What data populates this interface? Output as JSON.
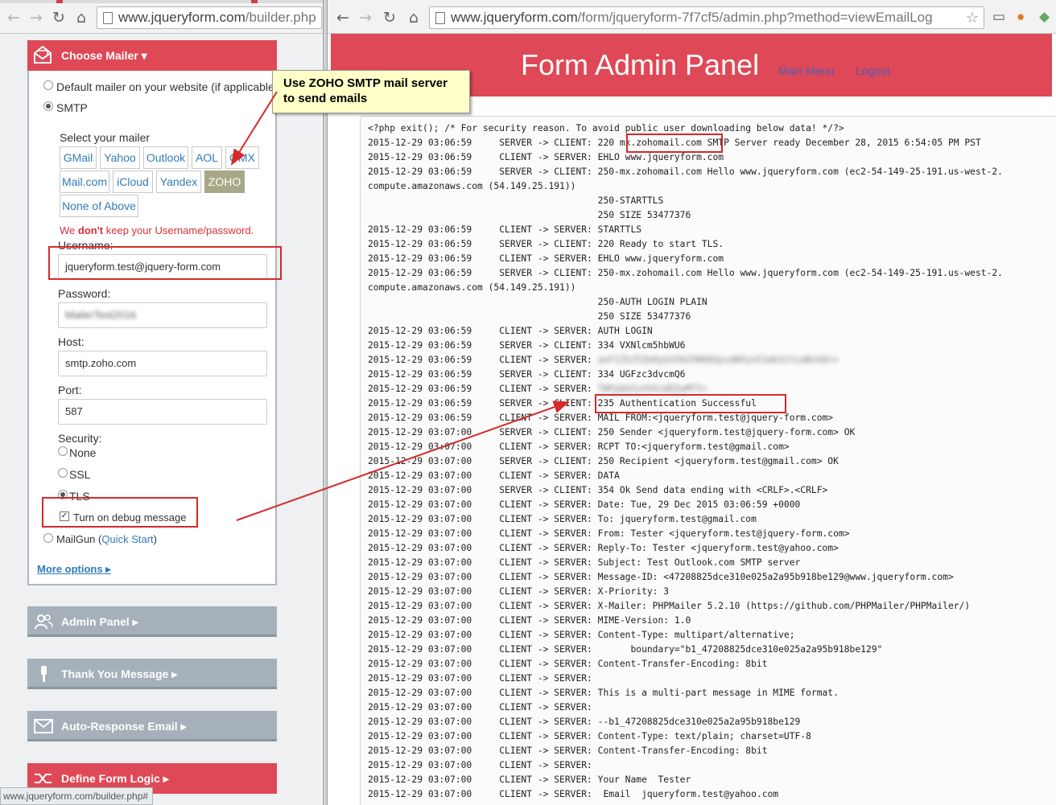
{
  "left_browser": {
    "url_host": "www.jqueryform.com",
    "url_rest": "/builder.php"
  },
  "right_browser": {
    "url_host": "www.jqueryform.com",
    "url_rest": "/form/jqueryform-7f7cf5/admin.php?method=viewEmailLog"
  },
  "mailer": {
    "title": "Choose Mailer ▾",
    "default_option": "Default mailer on your website (if applicable)",
    "smtp_option": "SMTP",
    "select_label": "Select your mailer",
    "buttons_row1": [
      "GMail",
      "Yahoo",
      "Outlook",
      "AOL",
      "GMX"
    ],
    "buttons_row2": [
      "Mail.com",
      "iCloud",
      "Yandex",
      "ZOHO"
    ],
    "buttons_row3": [
      "None of Above"
    ],
    "warning_pre": "We ",
    "warning_bold": "don't",
    "warning_post": " keep your Username/password.",
    "username_label": "Username:",
    "username_value": "jqueryform.test@jquery-form.com",
    "password_label": "Password:",
    "password_value": "MailerTest2016",
    "host_label": "Host:",
    "host_value": "smtp.zoho.com",
    "port_label": "Port:",
    "port_value": "587",
    "security_label": "Security:",
    "security_none": "None",
    "security_ssl": "SSL",
    "security_tls": "TLS",
    "debug_label": "Turn on debug message",
    "mailgun_label": "MailGun (",
    "mailgun_link": "Quick Start",
    "mailgun_close": ")",
    "more_options": "More options ▸"
  },
  "sections": {
    "admin_panel": "Admin Panel ▸",
    "thank_you": "Thank You Message ▸",
    "auto_response": "Auto-Response Email ▸",
    "form_logic": "Define Form Logic ▸"
  },
  "status_bar": "www.jqueryform.com/builder.php#",
  "callout": {
    "line1": "Use ZOHO SMTP mail server",
    "line2": "to send emails"
  },
  "admin": {
    "title": "Form Admin Panel",
    "main_menu": "Main Menu",
    "logout": "Logout"
  },
  "log_lines": [
    "<?php exit(); /* For security reason. To avoid public user downloading below data! */?>",
    "2015-12-29 03:06:59     SERVER -> CLIENT: 220 mx.zohomail.com SMTP Server ready December 28, 2015 6:54:05 PM PST",
    "2015-12-29 03:06:59     CLIENT -> SERVER: EHLO www.jqueryform.com",
    "2015-12-29 03:06:59     SERVER -> CLIENT: 250-mx.zohomail.com Hello www.jqueryform.com (ec2-54-149-25-191.us-west-2.",
    "compute.amazonaws.com (54.149.25.191))",
    "                                          250-STARTTLS",
    "                                          250 SIZE 53477376",
    "2015-12-29 03:06:59     CLIENT -> SERVER: STARTTLS",
    "2015-12-29 03:06:59     SERVER -> CLIENT: 220 Ready to start TLS.",
    "2015-12-29 03:06:59     CLIENT -> SERVER: EHLO www.jqueryform.com",
    "2015-12-29 03:06:59     SERVER -> CLIENT: 250-mx.zohomail.com Hello www.jqueryform.com (ec2-54-149-25-191.us-west-2.",
    "compute.amazonaws.com (54.149.25.191))",
    "                                          250-AUTH LOGIN PLAIN",
    "                                          250 SIZE 53477376",
    "2015-12-29 03:06:59     CLIENT -> SERVER: AUTH LOGIN",
    "2015-12-29 03:06:59     SERVER -> CLIENT: 334 VXNlcm5hbWU6",
    "2015-12-29 03:06:59     CLIENT -> SERVER: ",
    "2015-12-29 03:06:59     SERVER -> CLIENT: 334 UGFzc3dvcmQ6",
    "2015-12-29 03:06:59     CLIENT -> SERVER: ",
    "2015-12-29 03:06:59     SERVER -> CLIENT: 235 Authentication Successful",
    "2015-12-29 03:06:59     CLIENT -> SERVER: MAIL FROM:<jqueryform.test@jquery-form.com>",
    "2015-12-29 03:07:00     SERVER -> CLIENT: 250 Sender <jqueryform.test@jquery-form.com> OK",
    "2015-12-29 03:07:00     CLIENT -> SERVER: RCPT TO:<jqueryform.test@gmail.com>",
    "2015-12-29 03:07:00     SERVER -> CLIENT: 250 Recipient <jqueryform.test@gmail.com> OK",
    "2015-12-29 03:07:00     CLIENT -> SERVER: DATA",
    "2015-12-29 03:07:00     SERVER -> CLIENT: 354 Ok Send data ending with <CRLF>.<CRLF>",
    "2015-12-29 03:07:00     CLIENT -> SERVER: Date: Tue, 29 Dec 2015 03:06:59 +0000",
    "2015-12-29 03:07:00     CLIENT -> SERVER: To: jqueryform.test@gmail.com",
    "2015-12-29 03:07:00     CLIENT -> SERVER: From: Tester <jqueryform.test@jquery-form.com>",
    "2015-12-29 03:07:00     CLIENT -> SERVER: Reply-To: Tester <jqueryform.test@yahoo.com>",
    "2015-12-29 03:07:00     CLIENT -> SERVER: Subject: Test Outlook.com SMTP server",
    "2015-12-29 03:07:00     CLIENT -> SERVER: Message-ID: <47208825dce310e025a2a95b918be129@www.jqueryform.com>",
    "2015-12-29 03:07:00     CLIENT -> SERVER: X-Priority: 3",
    "2015-12-29 03:07:00     CLIENT -> SERVER: X-Mailer: PHPMailer 5.2.10 (https://github.com/PHPMailer/PHPMailer/)",
    "2015-12-29 03:07:00     CLIENT -> SERVER: MIME-Version: 1.0",
    "2015-12-29 03:07:00     CLIENT -> SERVER: Content-Type: multipart/alternative;",
    "2015-12-29 03:07:00     CLIENT -> SERVER:       boundary=\"b1_47208825dce310e025a2a95b918be129\"",
    "2015-12-29 03:07:00     CLIENT -> SERVER: Content-Transfer-Encoding: 8bit",
    "2015-12-29 03:07:00     CLIENT -> SERVER: ",
    "2015-12-29 03:07:00     CLIENT -> SERVER: This is a multi-part message in MIME format.",
    "2015-12-29 03:07:00     CLIENT -> SERVER: ",
    "2015-12-29 03:07:00     CLIENT -> SERVER: --b1_47208825dce310e025a2a95b918be129",
    "2015-12-29 03:07:00     CLIENT -> SERVER: Content-Type: text/plain; charset=UTF-8",
    "2015-12-29 03:07:00     CLIENT -> SERVER: Content-Transfer-Encoding: 8bit",
    "2015-12-29 03:07:00     CLIENT -> SERVER: ",
    "2015-12-29 03:07:00     CLIENT -> SERVER: Your Name  Tester",
    "2015-12-29 03:07:00     CLIENT -> SERVER:  Email  jqueryform.test@yahoo.com"
  ],
  "log_blurred_username": "anF1ZXJ5Zm9ybS50ZXN0QGpxdWVyeS1mb3JtLmNvbQ==",
  "log_blurred_password": "TWFpbGVyVGVzdDIwMTY="
}
